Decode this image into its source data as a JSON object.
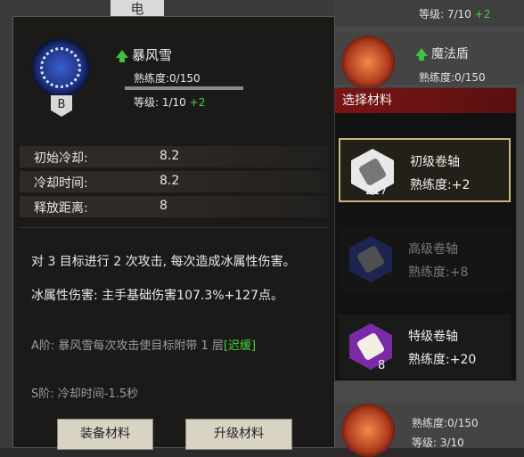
{
  "background": {
    "top_char": "电",
    "top_right_level": "等级: 7/10",
    "top_right_level_plus": "+2",
    "skill2_name": "魔法盾",
    "skill2_prof": "熟练度:0/150",
    "bottom_prof": "熟练度:0/150",
    "bottom_level": "等级: 3/10"
  },
  "skill": {
    "grade": "B",
    "name": "暴风雪",
    "proficiency": "熟练度:0/150",
    "level": "等级: 1/10",
    "level_plus": "+2",
    "proficiency_progress": 0
  },
  "stats": [
    {
      "label": "初始冷却:",
      "value": "8.2"
    },
    {
      "label": "冷却时间:",
      "value": "8.2"
    },
    {
      "label": "释放距离:",
      "value": "8"
    }
  ],
  "description": {
    "line1": "对 3 目标进行 2 次攻击, 每次造成冰属性伤害。",
    "line2": "冰属性伤害: 主手基础伤害107.3%+127点。",
    "a_tier_prefix": "A阶: 暴风雪每次攻击使目标附带 1 层",
    "a_tier_link": "[迟缓]",
    "s_tier": "S阶: 冷却时间-1.5秒"
  },
  "buttons": {
    "left": "装备材料",
    "right": "升级材料"
  },
  "materials": {
    "title": "选择材料",
    "items": [
      {
        "name": "初级卷轴",
        "proficiency": "熟练度:+2",
        "count": "217",
        "state": "selected"
      },
      {
        "name": "高级卷轴",
        "proficiency": "熟练度:+8",
        "count": "",
        "state": "disabled"
      },
      {
        "name": "特级卷轴",
        "proficiency": "熟练度:+20",
        "count": "8",
        "state": "normal"
      }
    ]
  },
  "colors": {
    "accent_green": "#3fd23f",
    "header_red": "#7a1414",
    "selected_border": "#c9b77a"
  }
}
